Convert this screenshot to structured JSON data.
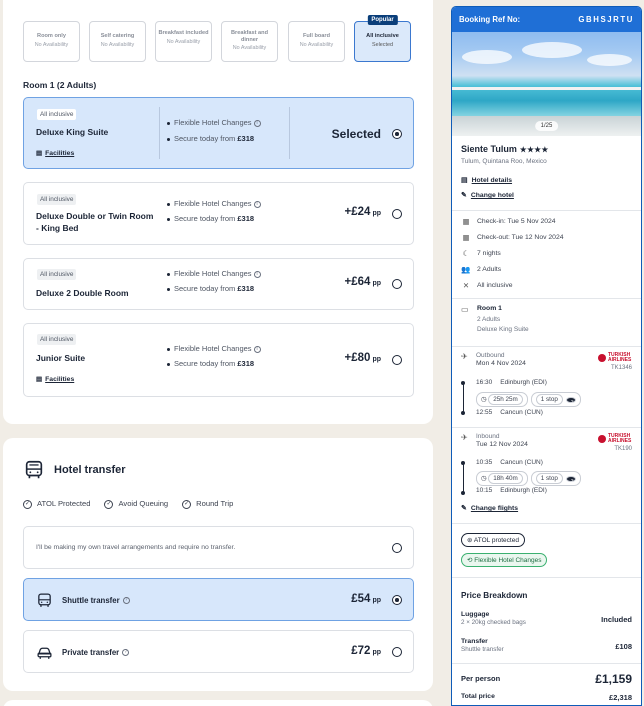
{
  "board_options": [
    {
      "title": "Room only",
      "status": "No Availability",
      "selected": false
    },
    {
      "title": "Self catering",
      "status": "No Availability",
      "selected": false
    },
    {
      "title": "Breakfast included",
      "status": "No Availability",
      "selected": false
    },
    {
      "title": "Breakfast and dinner",
      "status": "No Availability",
      "selected": false
    },
    {
      "title": "Full board",
      "status": "No Availability",
      "selected": false
    },
    {
      "title": "All inclusive",
      "status": "Selected",
      "selected": true,
      "tag": "Popular"
    }
  ],
  "room_heading": "Room 1 (2 Adults)",
  "rooms": [
    {
      "badge": "All inclusive",
      "name": "Deluxe King Suite",
      "facilities": "Facilities",
      "feature1": "Flexible Hotel Changes",
      "feature2_prefix": "Secure today from",
      "feature2_price": "£318",
      "price_label": "Selected",
      "selected": true
    },
    {
      "badge": "All inclusive",
      "name": "Deluxe Double or Twin Room - King Bed",
      "feature1": "Flexible Hotel Changes",
      "feature2_prefix": "Secure today from",
      "feature2_price": "£318",
      "price": "+£24",
      "unit": "pp",
      "selected": false
    },
    {
      "badge": "All inclusive",
      "name": "Deluxe 2 Double Room",
      "feature1": "Flexible Hotel Changes",
      "feature2_prefix": "Secure today from",
      "feature2_price": "£318",
      "price": "+£64",
      "unit": "pp",
      "selected": false
    },
    {
      "badge": "All inclusive",
      "name": "Junior Suite",
      "facilities": "Facilities",
      "feature1": "Flexible Hotel Changes",
      "feature2_prefix": "Secure today from",
      "feature2_price": "£318",
      "price": "+£80",
      "unit": "pp",
      "selected": false
    }
  ],
  "transfer": {
    "title": "Hotel transfer",
    "features": [
      "ATOL Protected",
      "Avoid Queuing",
      "Round Trip"
    ],
    "no_transfer": "I'll be making my own travel arrangements and require no transfer.",
    "options": [
      {
        "name": "Shuttle transfer",
        "price": "£54",
        "unit": "pp",
        "selected": true
      },
      {
        "name": "Private transfer",
        "price": "£72",
        "unit": "pp",
        "selected": false
      }
    ]
  },
  "booking": {
    "ref_label": "Booking Ref No:",
    "ref": "GBHSJRTU",
    "photo_pager": "1/25",
    "hotel_name": "Siente Tulum",
    "stars": "★★★★",
    "location": "Tulum, Quintana Roo, Mexico",
    "hotel_details": "Hotel details",
    "change_hotel": "Change hotel",
    "check_in": "Check-in: Tue 5 Nov 2024",
    "check_out": "Check-out: Tue 12 Nov 2024",
    "nights": "7 nights",
    "adults": "2 Adults",
    "board": "All inclusive",
    "room_title": "Room 1",
    "room_adults": "2 Adults",
    "room_type": "Deluxe King Suite",
    "outbound": {
      "label": "Outbound",
      "date": "Mon 4 Nov 2024",
      "airline": "TURKISH AIRLINES",
      "code": "TK1346",
      "dep_time": "16:30",
      "dep_airport": "Edinburgh (EDI)",
      "duration": "25h 25m",
      "stops": "1 stop",
      "arr_time": "12:55",
      "arr_airport": "Cancun (CUN)"
    },
    "inbound": {
      "label": "Inbound",
      "date": "Tue 12 Nov 2024",
      "airline": "TURKISH AIRLINES",
      "code": "TK190",
      "dep_time": "10:35",
      "dep_airport": "Cancun (CUN)",
      "duration": "18h 40m",
      "stops": "1 stop",
      "arr_time": "10:15",
      "arr_airport": "Edinburgh (EDI)"
    },
    "change_flights": "Change flights",
    "atol": "ATOL protected",
    "flex": "Flexible Hotel Changes",
    "price_breakdown": "Price Breakdown",
    "luggage_label": "Luggage",
    "luggage_sub": "2 × 20kg checked bags",
    "luggage_value": "Included",
    "transfer_label": "Transfer",
    "transfer_sub": "Shuttle transfer",
    "transfer_value": "£108",
    "per_person_label": "Per person",
    "per_person_value": "£1,159",
    "total_label": "Total price",
    "total_value": "£2,318"
  },
  "colors": {
    "accent": "#1f6fd6",
    "selected_bg": "#d7e7fb",
    "selected_border": "#6fa2e3",
    "dark": "#1c2536",
    "brand_airline": "#c8102e"
  }
}
